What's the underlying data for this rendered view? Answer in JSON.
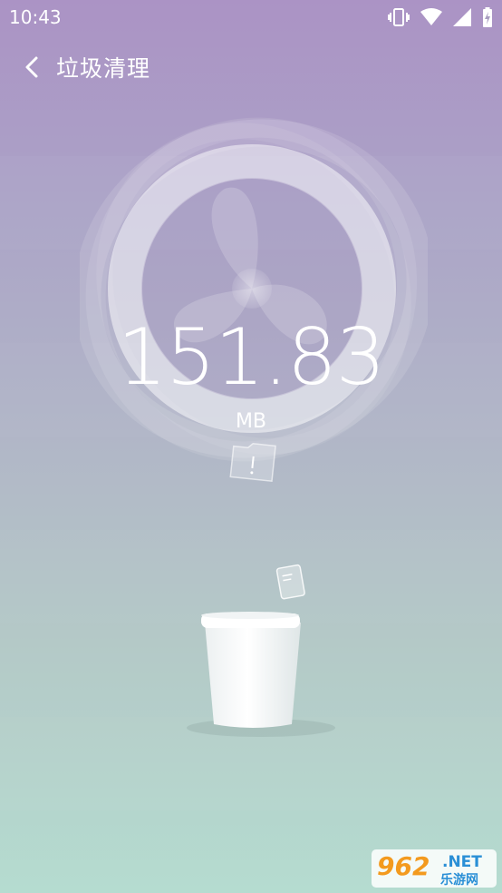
{
  "status_bar": {
    "time": "10:43",
    "icons": [
      "vibrate-icon",
      "wifi-icon",
      "signal-icon",
      "battery-charging-icon"
    ]
  },
  "header": {
    "back_icon": "chevron-left-icon",
    "title": "垃圾清理"
  },
  "scan": {
    "size_value": "151.83",
    "size_unit": "MB"
  },
  "watermark": {
    "brand_number": "962",
    "brand_suffix": ".NET",
    "brand_tagline": "乐游网"
  },
  "colors": {
    "top": "#ab93c5",
    "bottom": "#b5dcd0",
    "text": "#ffffff",
    "watermark_orange": "#f39a1e"
  }
}
